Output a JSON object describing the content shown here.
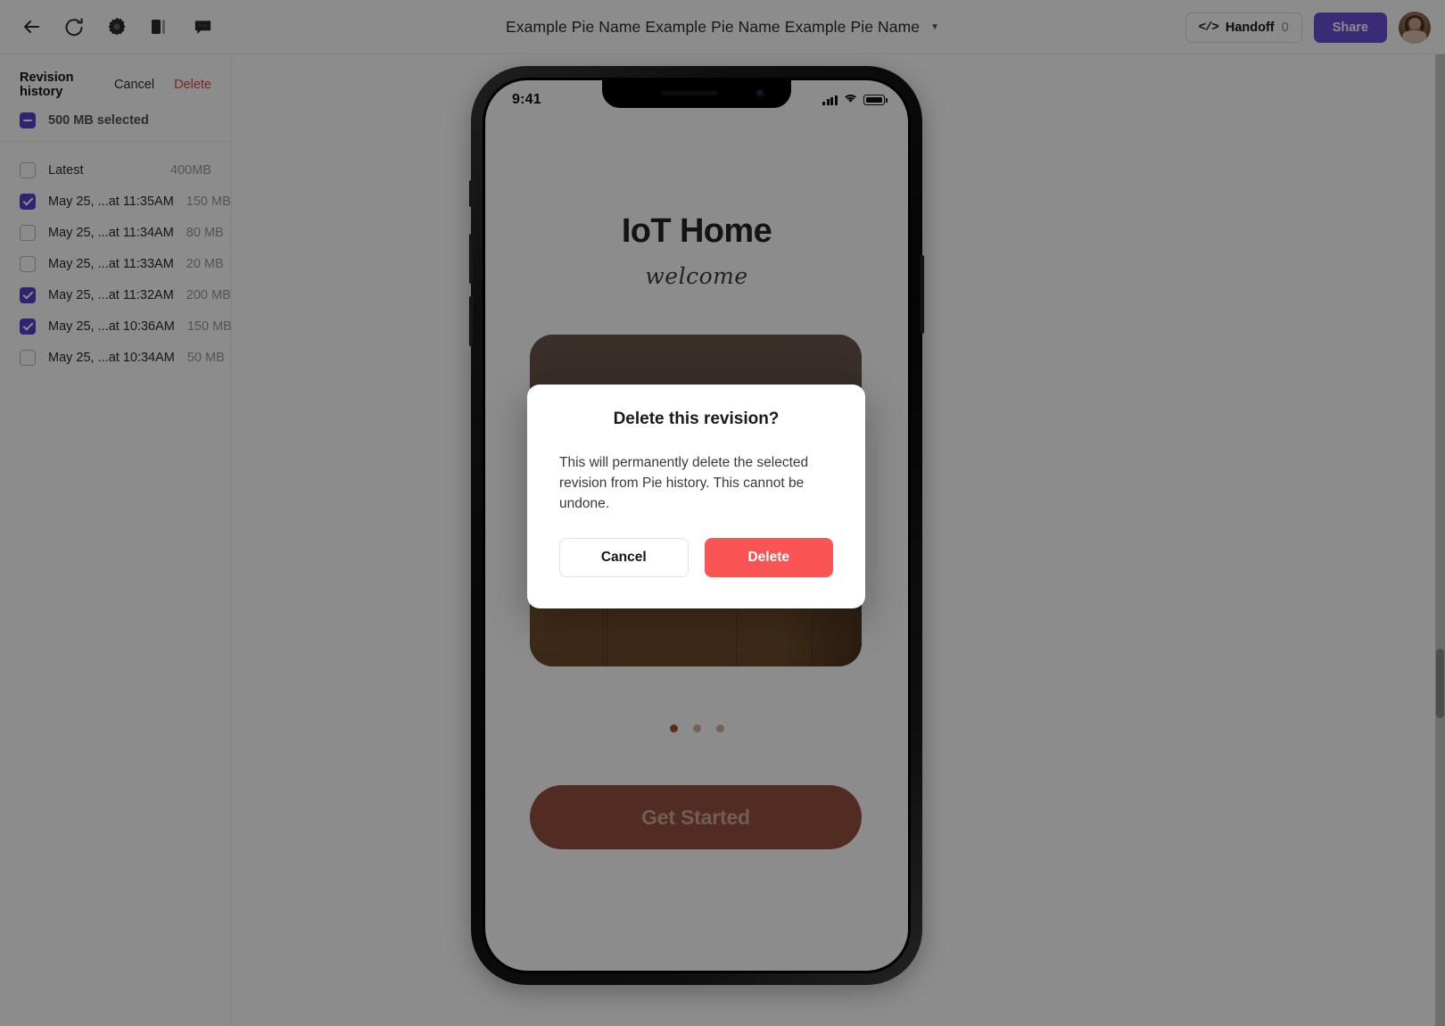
{
  "toolbar": {
    "icons": [
      {
        "name": "back-icon",
        "label": "Back"
      },
      {
        "name": "reload-icon",
        "label": "Reload"
      },
      {
        "name": "settings-gear-icon",
        "label": "Settings"
      },
      {
        "name": "split-panel-icon",
        "label": "Panels"
      },
      {
        "name": "comment-icon",
        "label": "Comments"
      }
    ],
    "title": "Example Pie Name Example Pie Name Example Pie Name",
    "title_caret": "▼",
    "handoff_glyph": "</>",
    "handoff_label": "Handoff",
    "handoff_count": "0",
    "share_label": "Share",
    "avatar_name": "user-avatar"
  },
  "sidebar": {
    "title": "Revision history",
    "cancel_label": "Cancel",
    "delete_label": "Delete",
    "selected_label": "500 MB selected",
    "select_all_state": "mixed",
    "revisions": [
      {
        "label": "Latest",
        "size": "400MB",
        "checked": false
      },
      {
        "label": "May 25, ...at 11:35AM",
        "size": "150 MB",
        "checked": true
      },
      {
        "label": "May 25, ...at 11:34AM",
        "size": "80 MB",
        "checked": false
      },
      {
        "label": "May 25, ...at 11:33AM",
        "size": "20 MB",
        "checked": false
      },
      {
        "label": "May 25, ...at 11:32AM",
        "size": "200 MB",
        "checked": true
      },
      {
        "label": "May 25, ...at 10:36AM",
        "size": "150 MB",
        "checked": true
      },
      {
        "label": "May 25, ...at 10:34AM",
        "size": "50 MB",
        "checked": false
      }
    ]
  },
  "preview": {
    "status_time": "9:41",
    "app_title": "IoT Home",
    "app_subtitle": "welcome",
    "cta_label": "Get Started",
    "carousel": {
      "count": 3,
      "active_index": 0
    }
  },
  "dialog": {
    "title": "Delete this revision?",
    "body": "This will permanently delete the selected revision from Pie history. This cannot be undone.",
    "cancel_label": "Cancel",
    "delete_label": "Delete"
  },
  "colors": {
    "accent_purple": "#5b3ecf",
    "share_purple": "#6b4fd8",
    "danger_red": "#e8463f",
    "delete_button": "#fb5454",
    "cta_brown": "#96503e",
    "dot_active": "#a4532f"
  }
}
